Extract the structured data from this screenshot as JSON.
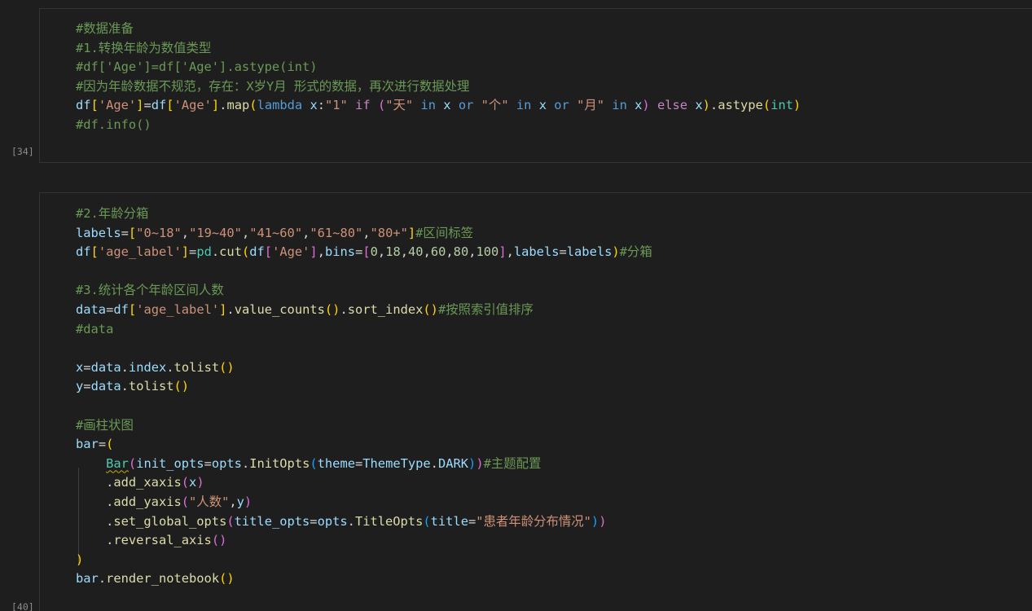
{
  "cells": [
    {
      "exec_count": "[34]",
      "lines": [
        [
          [
            "cm",
            "#数据准备"
          ]
        ],
        [
          [
            "cm",
            "#1.转换年龄为数值类型"
          ]
        ],
        [
          [
            "cm",
            "#df['Age']=df['Age'].astype(int)"
          ]
        ],
        [
          [
            "cm",
            "#因为年龄数据不规范，存在：X岁Y月 形式的数据，再次进行数据处理"
          ]
        ],
        [
          [
            "vr",
            "df"
          ],
          [
            "b1",
            "["
          ],
          [
            "st",
            "'Age'"
          ],
          [
            "b1",
            "]"
          ],
          [
            "op",
            "="
          ],
          [
            "vr",
            "df"
          ],
          [
            "b1",
            "["
          ],
          [
            "st",
            "'Age'"
          ],
          [
            "b1",
            "]"
          ],
          [
            "op",
            "."
          ],
          [
            "fn",
            "map"
          ],
          [
            "b1",
            "("
          ],
          [
            "kw",
            "lambda"
          ],
          [
            "op",
            " "
          ],
          [
            "vr",
            "x"
          ],
          [
            "op",
            ":"
          ],
          [
            "st",
            "\"1\""
          ],
          [
            "op",
            " "
          ],
          [
            "cf",
            "if"
          ],
          [
            "op",
            " "
          ],
          [
            "b2",
            "("
          ],
          [
            "st",
            "\"天\""
          ],
          [
            "op",
            " "
          ],
          [
            "kw",
            "in"
          ],
          [
            "op",
            " "
          ],
          [
            "vr",
            "x"
          ],
          [
            "op",
            " "
          ],
          [
            "kw",
            "or"
          ],
          [
            "op",
            " "
          ],
          [
            "st",
            "\"个\""
          ],
          [
            "op",
            " "
          ],
          [
            "kw",
            "in"
          ],
          [
            "op",
            " "
          ],
          [
            "vr",
            "x"
          ],
          [
            "op",
            " "
          ],
          [
            "kw",
            "or"
          ],
          [
            "op",
            " "
          ],
          [
            "st",
            "\"月\""
          ],
          [
            "op",
            " "
          ],
          [
            "kw",
            "in"
          ],
          [
            "op",
            " "
          ],
          [
            "vr",
            "x"
          ],
          [
            "b2",
            ")"
          ],
          [
            "op",
            " "
          ],
          [
            "cf",
            "else"
          ],
          [
            "op",
            " "
          ],
          [
            "vr",
            "x"
          ],
          [
            "b1",
            ")"
          ],
          [
            "op",
            "."
          ],
          [
            "fn",
            "astype"
          ],
          [
            "b1",
            "("
          ],
          [
            "ty",
            "int"
          ],
          [
            "b1",
            ")"
          ]
        ],
        [
          [
            "cm",
            "#df.info()"
          ]
        ]
      ]
    },
    {
      "exec_count": "[40]",
      "lines": [
        [
          [
            "cm",
            "#2.年龄分箱"
          ]
        ],
        [
          [
            "vr",
            "labels"
          ],
          [
            "op",
            "="
          ],
          [
            "b1",
            "["
          ],
          [
            "st",
            "\"0~18\""
          ],
          [
            "op",
            ","
          ],
          [
            "st",
            "\"19~40\""
          ],
          [
            "op",
            ","
          ],
          [
            "st",
            "\"41~60\""
          ],
          [
            "op",
            ","
          ],
          [
            "st",
            "\"61~80\""
          ],
          [
            "op",
            ","
          ],
          [
            "st",
            "\"80+\""
          ],
          [
            "b1",
            "]"
          ],
          [
            "cm",
            "#区间标签"
          ]
        ],
        [
          [
            "vr",
            "df"
          ],
          [
            "b1",
            "["
          ],
          [
            "st",
            "'age_label'"
          ],
          [
            "b1",
            "]"
          ],
          [
            "op",
            "="
          ],
          [
            "ty",
            "pd"
          ],
          [
            "op",
            "."
          ],
          [
            "fn",
            "cut"
          ],
          [
            "b1",
            "("
          ],
          [
            "vr",
            "df"
          ],
          [
            "b2",
            "["
          ],
          [
            "st",
            "'Age'"
          ],
          [
            "b2",
            "]"
          ],
          [
            "op",
            ","
          ],
          [
            "vr",
            "bins"
          ],
          [
            "op",
            "="
          ],
          [
            "b2",
            "["
          ],
          [
            "nm",
            "0"
          ],
          [
            "op",
            ","
          ],
          [
            "nm",
            "18"
          ],
          [
            "op",
            ","
          ],
          [
            "nm",
            "40"
          ],
          [
            "op",
            ","
          ],
          [
            "nm",
            "60"
          ],
          [
            "op",
            ","
          ],
          [
            "nm",
            "80"
          ],
          [
            "op",
            ","
          ],
          [
            "nm",
            "100"
          ],
          [
            "b2",
            "]"
          ],
          [
            "op",
            ","
          ],
          [
            "vr",
            "labels"
          ],
          [
            "op",
            "="
          ],
          [
            "vr",
            "labels"
          ],
          [
            "b1",
            ")"
          ],
          [
            "cm",
            "#分箱"
          ]
        ],
        [],
        [
          [
            "cm",
            "#3.统计各个年龄区间人数"
          ]
        ],
        [
          [
            "vr",
            "data"
          ],
          [
            "op",
            "="
          ],
          [
            "vr",
            "df"
          ],
          [
            "b1",
            "["
          ],
          [
            "st",
            "'age_label'"
          ],
          [
            "b1",
            "]"
          ],
          [
            "op",
            "."
          ],
          [
            "fn",
            "value_counts"
          ],
          [
            "b1",
            "()"
          ],
          [
            "op",
            "."
          ],
          [
            "fn",
            "sort_index"
          ],
          [
            "b1",
            "()"
          ],
          [
            "cm",
            "#按照索引值排序"
          ]
        ],
        [
          [
            "cm",
            "#data"
          ]
        ],
        [],
        [
          [
            "vr",
            "x"
          ],
          [
            "op",
            "="
          ],
          [
            "vr",
            "data"
          ],
          [
            "op",
            "."
          ],
          [
            "vr",
            "index"
          ],
          [
            "op",
            "."
          ],
          [
            "fn",
            "tolist"
          ],
          [
            "b1",
            "()"
          ]
        ],
        [
          [
            "vr",
            "y"
          ],
          [
            "op",
            "="
          ],
          [
            "vr",
            "data"
          ],
          [
            "op",
            "."
          ],
          [
            "fn",
            "tolist"
          ],
          [
            "b1",
            "()"
          ]
        ],
        [],
        [
          [
            "cm",
            "#画柱状图"
          ]
        ],
        [
          [
            "vr",
            "bar"
          ],
          [
            "op",
            "="
          ],
          [
            "b1",
            "("
          ]
        ],
        [
          [
            "op",
            "    "
          ],
          [
            "sq",
            "Bar"
          ],
          [
            "b2",
            "("
          ],
          [
            "vr",
            "init_opts"
          ],
          [
            "op",
            "="
          ],
          [
            "vr",
            "opts"
          ],
          [
            "op",
            "."
          ],
          [
            "fn",
            "InitOpts"
          ],
          [
            "b3",
            "("
          ],
          [
            "vr",
            "theme"
          ],
          [
            "op",
            "="
          ],
          [
            "vr",
            "ThemeType"
          ],
          [
            "op",
            "."
          ],
          [
            "vr",
            "DARK"
          ],
          [
            "b3",
            ")"
          ],
          [
            "b2",
            ")"
          ],
          [
            "cm",
            "#主题配置"
          ]
        ],
        [
          [
            "op",
            "    ."
          ],
          [
            "fn",
            "add_xaxis"
          ],
          [
            "b2",
            "("
          ],
          [
            "vr",
            "x"
          ],
          [
            "b2",
            ")"
          ]
        ],
        [
          [
            "op",
            "    ."
          ],
          [
            "fn",
            "add_yaxis"
          ],
          [
            "b2",
            "("
          ],
          [
            "st",
            "\"人数\""
          ],
          [
            "op",
            ","
          ],
          [
            "vr",
            "y"
          ],
          [
            "b2",
            ")"
          ]
        ],
        [
          [
            "op",
            "    ."
          ],
          [
            "fn",
            "set_global_opts"
          ],
          [
            "b2",
            "("
          ],
          [
            "vr",
            "title_opts"
          ],
          [
            "op",
            "="
          ],
          [
            "vr",
            "opts"
          ],
          [
            "op",
            "."
          ],
          [
            "fn",
            "TitleOpts"
          ],
          [
            "b3",
            "("
          ],
          [
            "vr",
            "title"
          ],
          [
            "op",
            "="
          ],
          [
            "st",
            "\"患者年龄分布情况\""
          ],
          [
            "b3",
            ")"
          ],
          [
            "b2",
            ")"
          ]
        ],
        [
          [
            "op",
            "    ."
          ],
          [
            "fn",
            "reversal_axis"
          ],
          [
            "b2",
            "()"
          ]
        ],
        [
          [
            "b1",
            ")"
          ]
        ],
        [
          [
            "vr",
            "bar"
          ],
          [
            "op",
            "."
          ],
          [
            "fn",
            "render_notebook"
          ],
          [
            "b1",
            "()"
          ]
        ]
      ]
    }
  ]
}
